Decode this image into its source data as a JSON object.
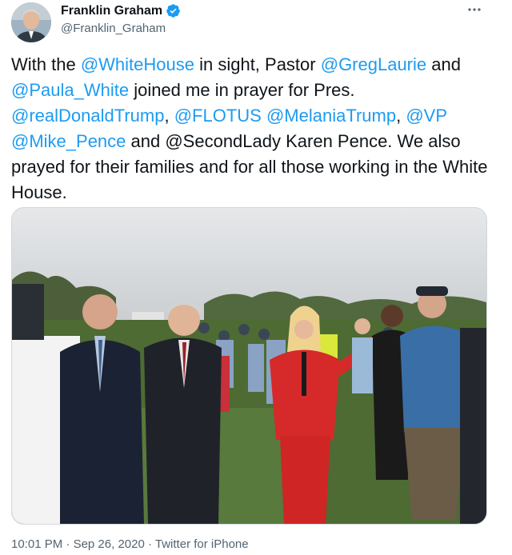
{
  "author": {
    "name": "Franklin Graham",
    "handle": "@Franklin_Graham",
    "verified": true
  },
  "more_icon": "more-horizontal-icon",
  "tweet_text": {
    "segments": [
      {
        "t": "With the ",
        "m": false
      },
      {
        "t": "@WhiteHouse",
        "m": true
      },
      {
        "t": " in sight, Pastor ",
        "m": false
      },
      {
        "t": "@GregLaurie",
        "m": true
      },
      {
        "t": " and ",
        "m": false
      },
      {
        "t": "@Paula_White",
        "m": true
      },
      {
        "t": " joined me in prayer for Pres. ",
        "m": false
      },
      {
        "t": "@realDonaldTrump",
        "m": true
      },
      {
        "t": ", ",
        "m": false
      },
      {
        "t": "@FLOTUS",
        "m": true
      },
      {
        "t": " ",
        "m": false
      },
      {
        "t": "@MelaniaTrump",
        "m": true
      },
      {
        "t": ", ",
        "m": false
      },
      {
        "t": "@VP",
        "m": true
      },
      {
        "t": " ",
        "m": false
      },
      {
        "t": "@Mike_Pence",
        "m": true
      },
      {
        "t": " and @SecondLady Karen Pence. We also prayed for their families and for all those working in the White House.",
        "m": false
      }
    ]
  },
  "meta": {
    "time": "10:01 PM",
    "separator": "·",
    "date": "Sep 26, 2020",
    "source": "Twitter for iPhone"
  },
  "colors": {
    "link": "#1d9bf0",
    "verified_badge": "#1d9bf0",
    "secondary_text": "#536471",
    "red_suit": "#d62a2a"
  }
}
